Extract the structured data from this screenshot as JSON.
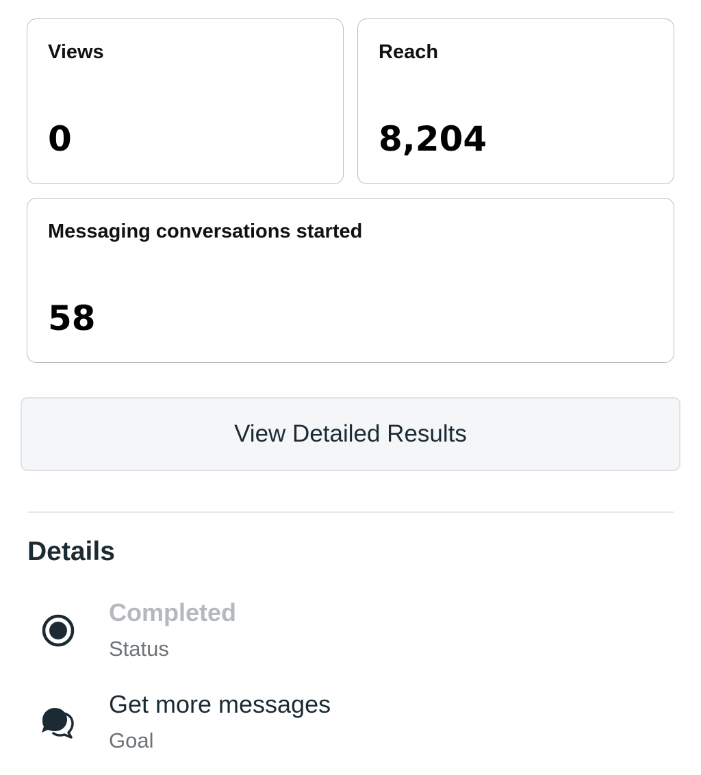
{
  "metrics": {
    "views": {
      "label": "Views",
      "value": "0"
    },
    "reach": {
      "label": "Reach",
      "value": "8,204"
    },
    "messaging": {
      "label": "Messaging conversations started",
      "value": "58"
    }
  },
  "actions": {
    "view_detailed_results": "View Detailed Results"
  },
  "details": {
    "title": "Details",
    "items": [
      {
        "primary": "Completed",
        "secondary": "Status",
        "icon": "radio-selected-icon"
      },
      {
        "primary": "Get more messages",
        "secondary": "Goal",
        "icon": "chat-bubbles-icon"
      }
    ]
  },
  "colors": {
    "text_primary": "#1c2b33",
    "text_muted": "#b5b9bd",
    "text_secondary": "#6e7378",
    "card_border": "#b9bdc2",
    "button_bg": "#f4f6f8"
  }
}
